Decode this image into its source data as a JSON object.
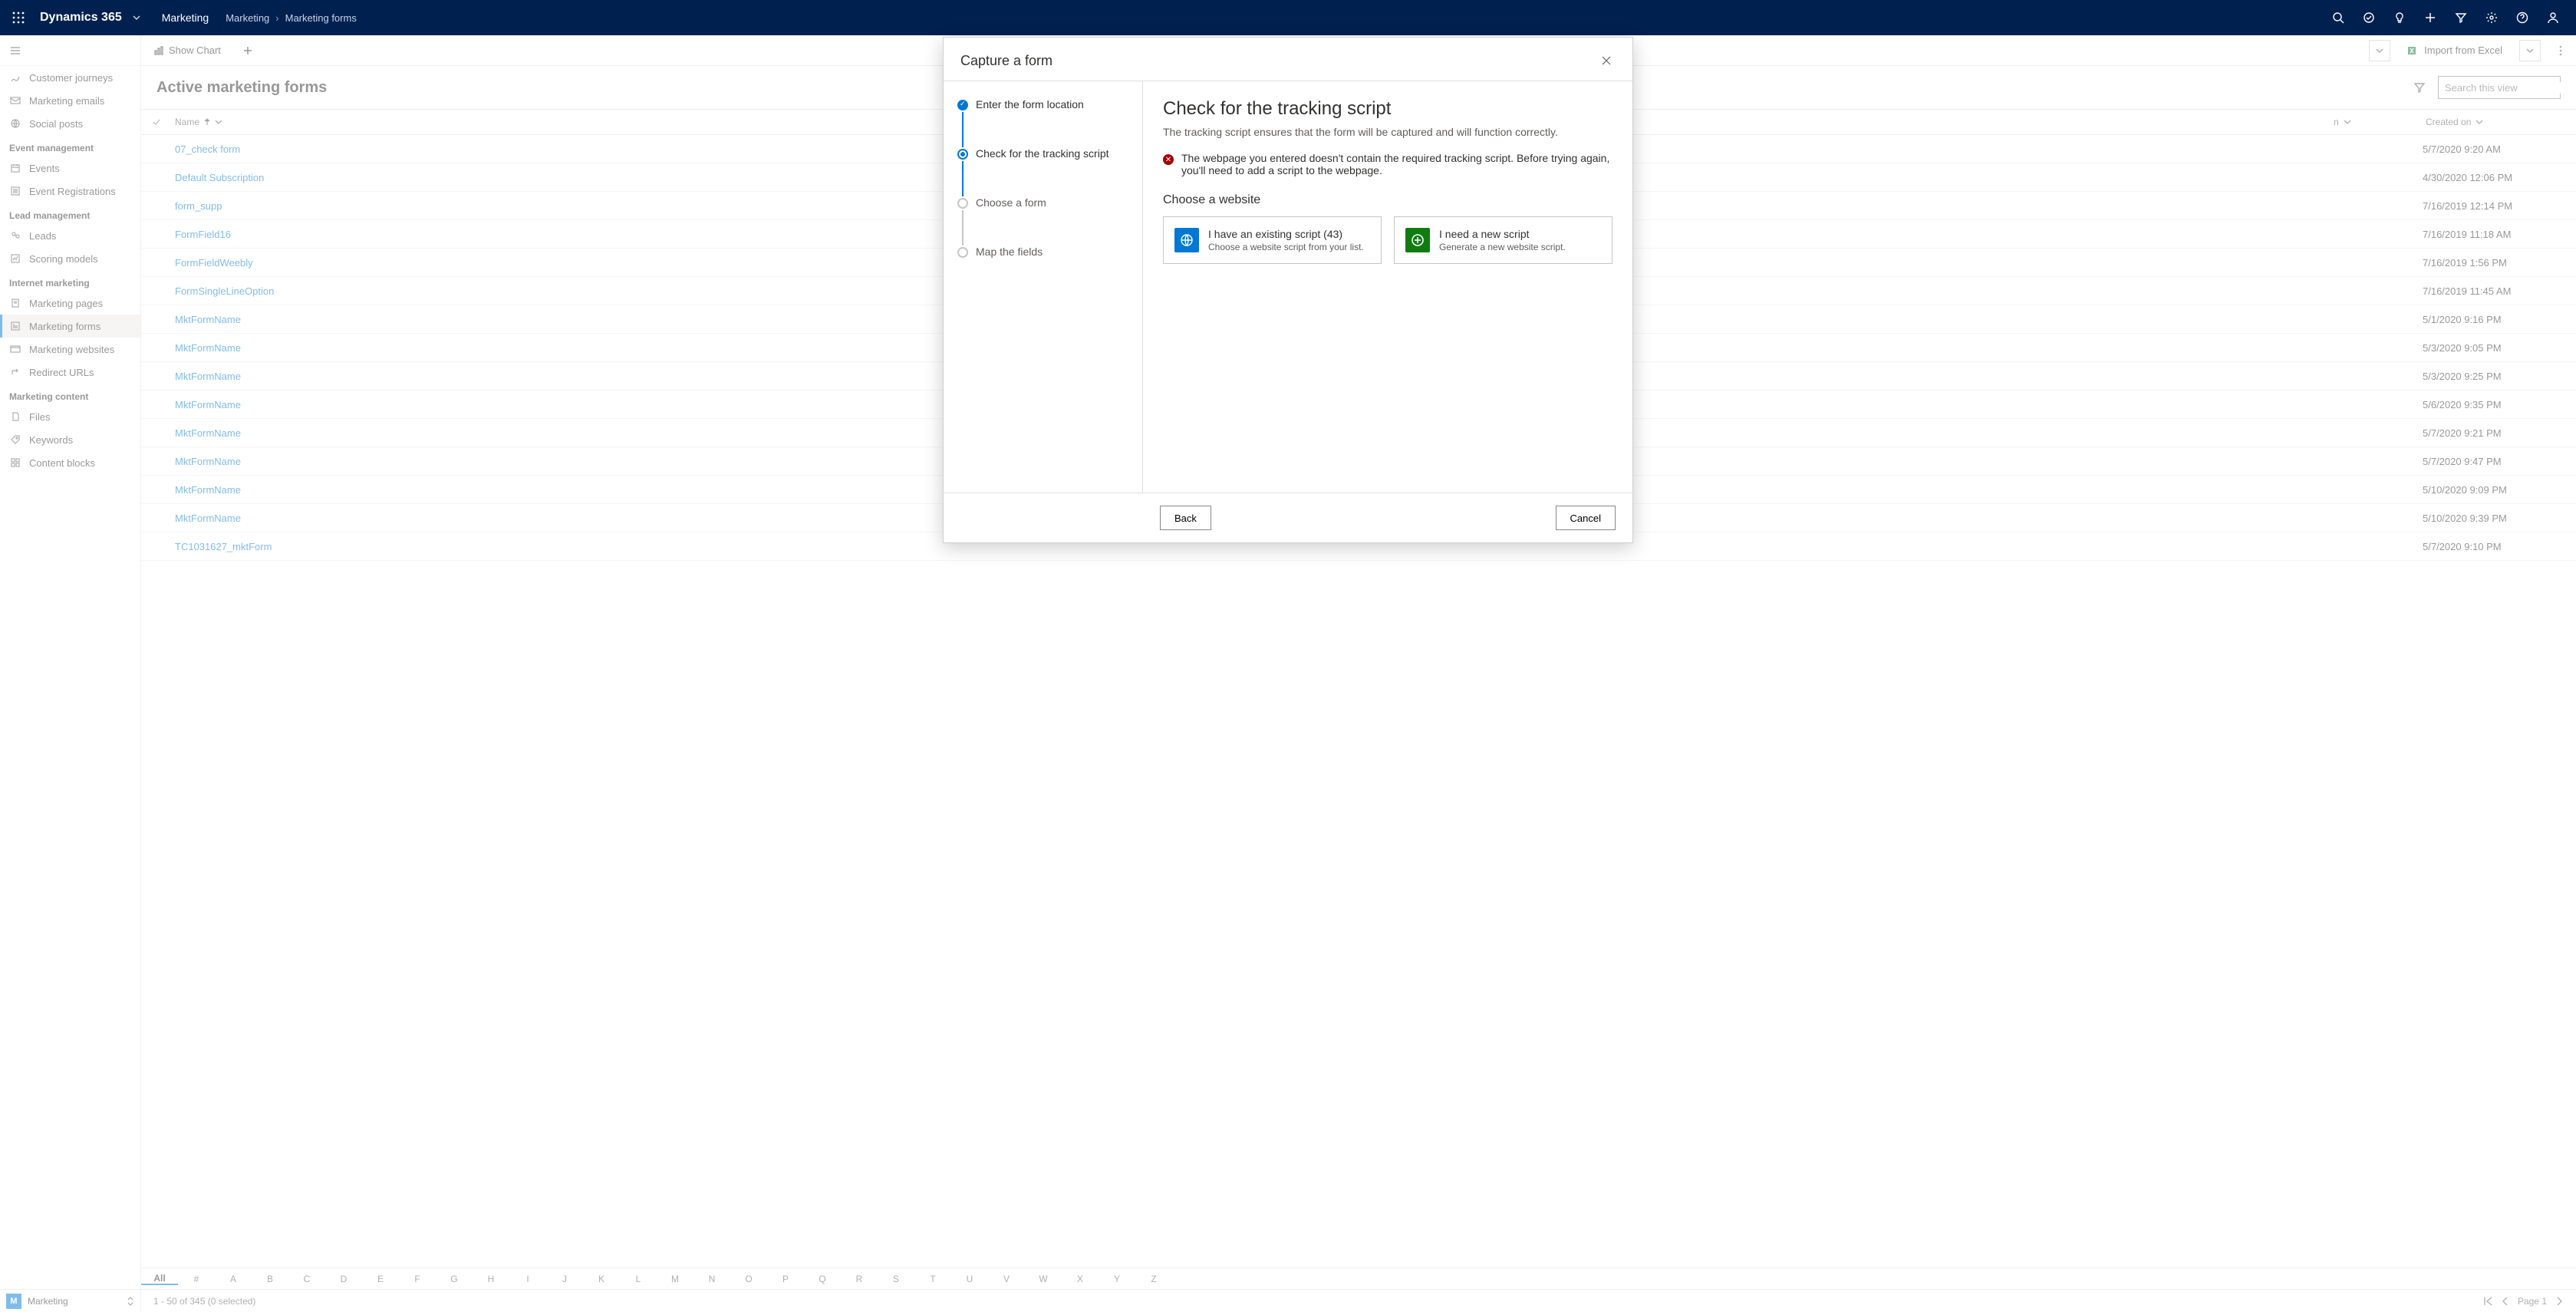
{
  "topbar": {
    "brand": "Dynamics 365",
    "area": "Marketing",
    "breadcrumb": [
      "Marketing",
      "Marketing forms"
    ]
  },
  "sidebar": {
    "items": [
      {
        "label": "Customer journeys"
      },
      {
        "label": "Marketing emails"
      },
      {
        "label": "Social posts"
      }
    ],
    "sections": [
      {
        "title": "Event management",
        "items": [
          {
            "label": "Events"
          },
          {
            "label": "Event Registrations"
          }
        ]
      },
      {
        "title": "Lead management",
        "items": [
          {
            "label": "Leads"
          },
          {
            "label": "Scoring models"
          }
        ]
      },
      {
        "title": "Internet marketing",
        "items": [
          {
            "label": "Marketing pages"
          },
          {
            "label": "Marketing forms",
            "selected": true
          },
          {
            "label": "Marketing websites"
          },
          {
            "label": "Redirect URLs"
          }
        ]
      },
      {
        "title": "Marketing content",
        "items": [
          {
            "label": "Files"
          },
          {
            "label": "Keywords"
          },
          {
            "label": "Content blocks"
          }
        ]
      }
    ]
  },
  "cmdbar": {
    "showChart": "Show Chart",
    "import": "Import from Excel"
  },
  "view": {
    "title": "Active marketing forms",
    "searchPlaceholder": "Search this view"
  },
  "columns": {
    "name": "Name",
    "mod": "n",
    "created": "Created on"
  },
  "rows": [
    {
      "name": "07_check form",
      "date": "5/7/2020 9:20 AM"
    },
    {
      "name": "Default Subscription",
      "date": "4/30/2020 12:06 PM"
    },
    {
      "name": "form_supp",
      "date": "7/16/2019 12:14 PM"
    },
    {
      "name": "FormField16",
      "date": "7/16/2019 11:18 AM"
    },
    {
      "name": "FormFieldWeebly",
      "date": "7/16/2019 1:56 PM"
    },
    {
      "name": "FormSingleLineOption",
      "date": "7/16/2019 11:45 AM"
    },
    {
      "name": "MktFormName",
      "date": "5/1/2020 9:16 PM"
    },
    {
      "name": "MktFormName",
      "date": "5/3/2020 9:05 PM"
    },
    {
      "name": "MktFormName",
      "date": "5/3/2020 9:25 PM"
    },
    {
      "name": "MktFormName",
      "date": "5/6/2020 9:35 PM"
    },
    {
      "name": "MktFormName",
      "date": "5/7/2020 9:21 PM"
    },
    {
      "name": "MktFormName",
      "date": "5/7/2020 9:47 PM"
    },
    {
      "name": "MktFormName",
      "date": "5/10/2020 9:09 PM"
    },
    {
      "name": "MktFormName",
      "date": "5/10/2020 9:39 PM"
    },
    {
      "name": "TC1031627_mktForm",
      "date": "5/7/2020 9:10 PM"
    }
  ],
  "alpha": [
    "All",
    "#",
    "A",
    "B",
    "C",
    "D",
    "E",
    "F",
    "G",
    "H",
    "I",
    "J",
    "K",
    "L",
    "M",
    "N",
    "O",
    "P",
    "Q",
    "R",
    "S",
    "T",
    "U",
    "V",
    "W",
    "X",
    "Y",
    "Z"
  ],
  "footer": {
    "areaLetter": "M",
    "areaName": "Marketing",
    "count": "1 - 50 of 345 (0 selected)",
    "page": "Page 1"
  },
  "dialog": {
    "title": "Capture a form",
    "steps": [
      {
        "label": "Enter the form location",
        "state": "done"
      },
      {
        "label": "Check for the tracking script",
        "state": "active"
      },
      {
        "label": "Choose a form",
        "state": "pending"
      },
      {
        "label": "Map the fields",
        "state": "pending"
      }
    ],
    "heading": "Check for the tracking script",
    "subheading": "The tracking script ensures that the form will be captured and will function correctly.",
    "error": "The webpage you entered doesn't contain the required tracking script. Before trying again, you'll need to add a script to the webpage.",
    "chooseLabel": "Choose a website",
    "options": [
      {
        "title": "I have an existing script (43)",
        "desc": "Choose a website script from your list.",
        "color": "blue",
        "glyph": "globe"
      },
      {
        "title": "I need a new script",
        "desc": "Generate a new website script.",
        "color": "green",
        "glyph": "plus"
      }
    ],
    "back": "Back",
    "cancel": "Cancel"
  }
}
